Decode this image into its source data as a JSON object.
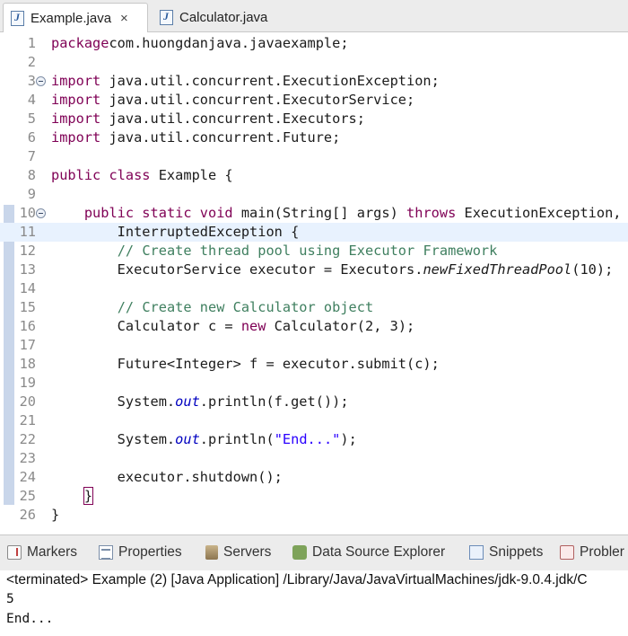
{
  "editor_tabs": [
    {
      "label": "Example.java",
      "close": "×",
      "active": true
    },
    {
      "label": "Calculator.java",
      "active": false
    }
  ],
  "code_lines": [
    {
      "n": "1",
      "segs": [
        [
          "kw",
          "package"
        ],
        [
          "",
          "com.huongdanjava.javaexample;"
        ]
      ]
    },
    {
      "n": "2",
      "segs": []
    },
    {
      "n": "3",
      "fold": true,
      "segs": [
        [
          "kw",
          "import"
        ],
        [
          "",
          " java.util.concurrent.ExecutionException;"
        ]
      ]
    },
    {
      "n": "4",
      "segs": [
        [
          "kw",
          "import"
        ],
        [
          "",
          " java.util.concurrent.ExecutorService;"
        ]
      ]
    },
    {
      "n": "5",
      "segs": [
        [
          "kw",
          "import"
        ],
        [
          "",
          " java.util.concurrent.Executors;"
        ]
      ]
    },
    {
      "n": "6",
      "segs": [
        [
          "kw",
          "import"
        ],
        [
          "",
          " java.util.concurrent.Future;"
        ]
      ]
    },
    {
      "n": "7",
      "segs": []
    },
    {
      "n": "8",
      "segs": [
        [
          "kw",
          "public class"
        ],
        [
          "",
          " Example {"
        ]
      ]
    },
    {
      "n": "9",
      "segs": []
    },
    {
      "n": "10",
      "fold": true,
      "segs": [
        [
          "",
          "    "
        ],
        [
          "kw",
          "public static void"
        ],
        [
          "",
          " main(String[] args) "
        ],
        [
          "kw",
          "throws"
        ],
        [
          "",
          " ExecutionException,"
        ]
      ]
    },
    {
      "n": "11",
      "current": true,
      "segs": [
        [
          "",
          "        InterruptedException {"
        ]
      ]
    },
    {
      "n": "12",
      "segs": [
        [
          "",
          "        "
        ],
        [
          "cm",
          "// Create thread pool using Executor Framework"
        ]
      ]
    },
    {
      "n": "13",
      "segs": [
        [
          "",
          "        ExecutorService "
        ],
        [
          "",
          "executor"
        ],
        [
          "",
          " = Executors."
        ],
        [
          "it",
          "newFixedThreadPool"
        ],
        [
          "",
          "(10);"
        ]
      ]
    },
    {
      "n": "14",
      "segs": []
    },
    {
      "n": "15",
      "segs": [
        [
          "",
          "        "
        ],
        [
          "cm",
          "// Create new Calculator object"
        ]
      ]
    },
    {
      "n": "16",
      "segs": [
        [
          "",
          "        Calculator c = "
        ],
        [
          "kw",
          "new"
        ],
        [
          "",
          " Calculator(2, 3);"
        ]
      ]
    },
    {
      "n": "17",
      "segs": []
    },
    {
      "n": "18",
      "segs": [
        [
          "",
          "        Future<Integer> f = executor.submit(c);"
        ]
      ]
    },
    {
      "n": "19",
      "segs": []
    },
    {
      "n": "20",
      "segs": [
        [
          "",
          "        System."
        ],
        [
          "fld",
          "out"
        ],
        [
          "",
          ".println(f.get());"
        ]
      ]
    },
    {
      "n": "21",
      "segs": []
    },
    {
      "n": "22",
      "segs": [
        [
          "",
          "        System."
        ],
        [
          "fld",
          "out"
        ],
        [
          "",
          ".println("
        ],
        [
          "st",
          "\"End...\""
        ],
        [
          "",
          ");"
        ]
      ]
    },
    {
      "n": "23",
      "segs": []
    },
    {
      "n": "24",
      "segs": [
        [
          "",
          "        executor.shutdown();"
        ]
      ]
    },
    {
      "n": "25",
      "segs": [
        [
          "",
          "    "
        ],
        [
          "brk",
          "}"
        ]
      ]
    },
    {
      "n": "26",
      "segs": [
        [
          "",
          "}"
        ]
      ]
    }
  ],
  "view_tabs": [
    {
      "label": "Markers",
      "icon": "markers-icon"
    },
    {
      "label": "Properties",
      "icon": "properties-icon"
    },
    {
      "label": "Servers",
      "icon": "servers-icon"
    },
    {
      "label": "Data Source Explorer",
      "icon": "data-source-explorer-icon"
    },
    {
      "label": "Snippets",
      "icon": "snippets-icon"
    },
    {
      "label": "Probler",
      "icon": "problems-icon"
    }
  ],
  "console": {
    "header": "<terminated> Example (2) [Java Application] /Library/Java/JavaVirtualMachines/jdk-9.0.4.jdk/C",
    "output": [
      "5",
      "End..."
    ]
  },
  "colors": {
    "keyword": "#7f0055",
    "comment": "#3f7f5f",
    "string": "#2a00ff",
    "static_field": "#0000c0",
    "current_line": "#e8f2fe"
  }
}
